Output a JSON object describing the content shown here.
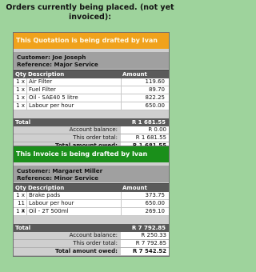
{
  "heading": "Orders currently being placed. (not yet invoiced):",
  "columns": {
    "qty": "Qty",
    "description": "Description",
    "amount": "Amount"
  },
  "labels": {
    "total": "Total",
    "account_balance": "Account balance:",
    "this_order_total": "This order total:",
    "total_amount_owed": "Total amount owed:"
  },
  "colors": {
    "quotation_banner": "#f0a21c",
    "invoice_banner": "#1a8f1a",
    "background": "#9ed39c"
  },
  "orders": [
    {
      "banner": "This Quotation is being drafted by Ivan",
      "customer": "Customer: Joe Joseph",
      "reference": "Reference: Major Service",
      "items": [
        {
          "qty": "1 x",
          "description": "Air Filter",
          "amount": "119.60"
        },
        {
          "qty": "1 x",
          "description": "Fuel Filter",
          "amount": "89.70"
        },
        {
          "qty": "1 x",
          "description": "Oil - SAE40 5 litre",
          "amount": "822.25"
        },
        {
          "qty": "1 x",
          "description": "Labour per hour",
          "amount": "650.00"
        }
      ],
      "total": "R 1 681.55",
      "account_balance": "R 0.00",
      "this_order_total": "R 1 681.55",
      "total_amount_owed": "R 1 681.55"
    },
    {
      "banner": "This Invoice is being drafted by Ivan",
      "customer": "Customer: Margaret Miller",
      "reference": "Reference: Minor Service",
      "items": [
        {
          "qty": "1 x",
          "description": "Brake pads",
          "amount": "373.75"
        },
        {
          "qty": "11 x",
          "description": "Labour per hour",
          "amount": "650.00"
        },
        {
          "qty": "1 x",
          "description": "Oil - 2T 500ml",
          "amount": "269.10"
        }
      ],
      "total": "R 7 792.85",
      "account_balance": "R 250.33",
      "this_order_total": "R 7 792.85",
      "total_amount_owed": "R 7 542.52"
    }
  ]
}
